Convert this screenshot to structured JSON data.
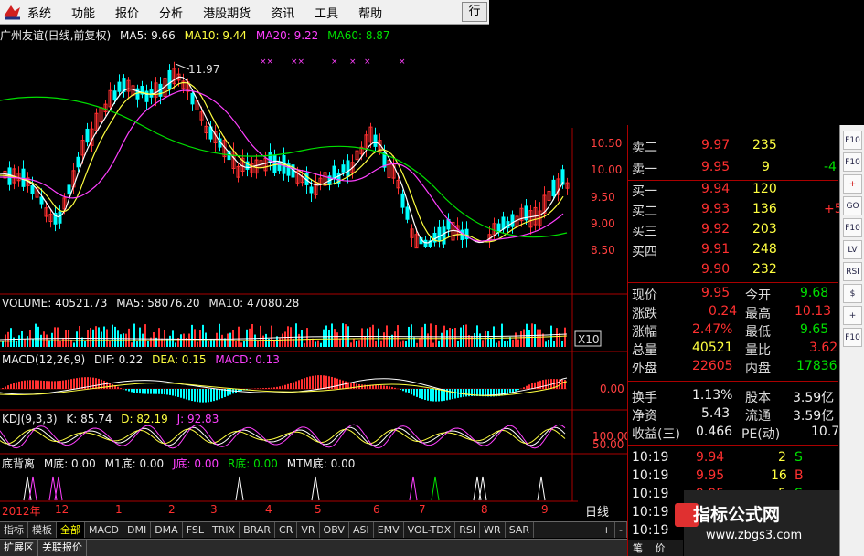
{
  "menu": {
    "items": [
      "系统",
      "功能",
      "报价",
      "分析",
      "港股期货",
      "资讯",
      "工具",
      "帮助"
    ],
    "right_button": "行"
  },
  "info": {
    "stock": "广州友谊(日线,前复权)",
    "ma5": "MA5: 9.66",
    "ma10": "MA10: 9.44",
    "ma20": "MA20: 9.22",
    "ma60": "MA60: 8.87"
  },
  "price_axis": [
    "10.50",
    "10.00",
    "9.50",
    "9.00",
    "8.50"
  ],
  "high_label": "11.97",
  "volume": {
    "label": "VOLUME: 40521.73",
    "ma5": "MA5: 58076.20",
    "ma10": "MA10: 47080.28",
    "scale": "X10"
  },
  "macd": {
    "label": "MACD(12,26,9)",
    "dif": "DIF: 0.22",
    "dea": "DEA: 0.15",
    "macd": "MACD: 0.13",
    "zero": "0.00"
  },
  "kdj": {
    "label": "KDJ(9,3,3)",
    "k": "K: 85.74",
    "d": "D: 82.19",
    "j": "J: 92.83",
    "top": "100.00",
    "mid": "50.00"
  },
  "bottom": {
    "label": "底背离",
    "m": "M底: 0.00",
    "m1": "M1底: 0.00",
    "j": "J底: 0.00",
    "r": "R底: 0.00",
    "mtm": "MTM底: 0.00"
  },
  "xaxis": [
    "2012年",
    "12",
    "1",
    "2",
    "3",
    "4",
    "5",
    "6",
    "7",
    "8",
    "9"
  ],
  "day_label": "日线",
  "day_controls": [
    "+",
    "-",
    "□"
  ],
  "quote": {
    "sells": [
      {
        "label": "卖二",
        "price": "9.97",
        "vol": "235"
      },
      {
        "label": "卖一",
        "price": "9.95",
        "vol": "9",
        "extra": "-4"
      }
    ],
    "buys": [
      {
        "label": "买一",
        "price": "9.94",
        "vol": "120"
      },
      {
        "label": "买二",
        "price": "9.93",
        "vol": "136",
        "extra": "+5"
      },
      {
        "label": "买三",
        "price": "9.92",
        "vol": "203"
      },
      {
        "label": "买四",
        "price": "9.91",
        "vol": "248"
      },
      {
        "label": "",
        "price": "9.90",
        "vol": "232"
      }
    ],
    "stats": [
      {
        "l1": "现价",
        "v1": "9.95",
        "l2": "今开",
        "v2": "9.68"
      },
      {
        "l1": "涨跌",
        "v1": "0.24",
        "l2": "最高",
        "v2": "10.13"
      },
      {
        "l1": "涨幅",
        "v1": "2.47%",
        "l2": "最低",
        "v2": "9.65"
      },
      {
        "l1": "总量",
        "v1": "40521",
        "l2": "量比",
        "v2": "3.62"
      },
      {
        "l1": "外盘",
        "v1": "22605",
        "l2": "内盘",
        "v2": "17836"
      }
    ],
    "stats2": [
      {
        "l1": "换手",
        "v1": "1.13%",
        "l2": "股本",
        "v2": "3.59亿"
      },
      {
        "l1": "净资",
        "v1": "5.43",
        "l2": "流通",
        "v2": "3.59亿"
      },
      {
        "l1": "收益(三)",
        "v1": "0.466",
        "l2": "PE(动)",
        "v2": "10.7"
      }
    ],
    "ticks": [
      {
        "t": "10:19",
        "p": "9.94",
        "v": "2",
        "d": "S"
      },
      {
        "t": "10:19",
        "p": "9.95",
        "v": "16",
        "d": "B"
      },
      {
        "t": "10:19",
        "p": "9.95",
        "v": "5",
        "d": "S"
      },
      {
        "t": "10:19",
        "p": "",
        "v": "",
        "d": ""
      },
      {
        "t": "10:19",
        "p": "",
        "v": "",
        "d": ""
      }
    ],
    "bottom_tabs": [
      "笔",
      "价"
    ]
  },
  "sidebar": [
    "F10",
    "F10",
    "+",
    "GO",
    "F10",
    "LV",
    "RSI",
    "$",
    "+",
    "F10"
  ],
  "tabs": [
    "指标",
    "模板",
    "全部",
    "MACD",
    "DMI",
    "DMA",
    "FSL",
    "TRIX",
    "BRAR",
    "CR",
    "VR",
    "OBV",
    "ASI",
    "EMV",
    "VOL-TDX",
    "RSI",
    "WR",
    "SAR"
  ],
  "tabs_right": [
    "+",
    "-"
  ],
  "status": [
    "扩展区",
    "关联报价"
  ],
  "watermark": {
    "title": "指标公式网",
    "url": "www.zbgs3.com"
  },
  "colors": {
    "up": "#ff3030",
    "down": "#00ffff",
    "ma5": "#ffffff",
    "ma10": "#ffff40",
    "ma20": "#ff40ff",
    "ma60": "#00e000"
  }
}
